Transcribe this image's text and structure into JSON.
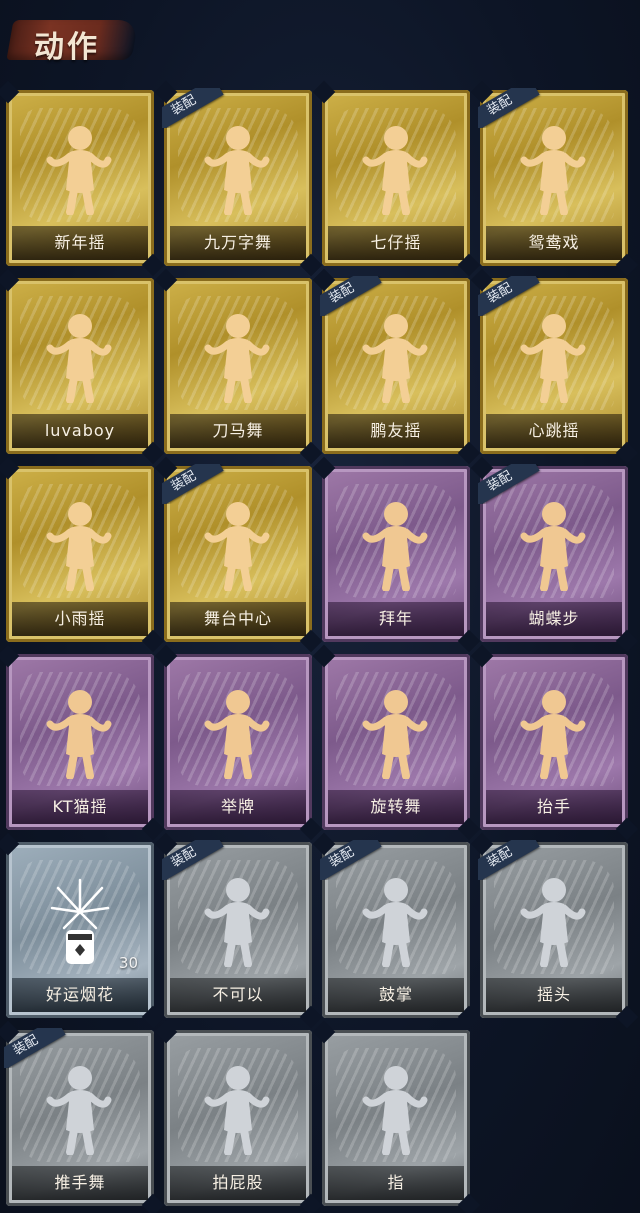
{
  "header": {
    "title": "动作"
  },
  "badge_text": "装配",
  "cards": [
    {
      "label": "新年摇",
      "rarity": "gold",
      "equipped": false
    },
    {
      "label": "九万字舞",
      "rarity": "gold",
      "equipped": true
    },
    {
      "label": "七仔摇",
      "rarity": "gold",
      "equipped": false
    },
    {
      "label": "鸳鸯戏",
      "rarity": "gold",
      "equipped": true
    },
    {
      "label": "luvaboy",
      "rarity": "gold",
      "equipped": false
    },
    {
      "label": "刀马舞",
      "rarity": "gold",
      "equipped": false
    },
    {
      "label": "鹏友摇",
      "rarity": "gold",
      "equipped": true
    },
    {
      "label": "心跳摇",
      "rarity": "gold",
      "equipped": true
    },
    {
      "label": "小雨摇",
      "rarity": "gold",
      "equipped": false
    },
    {
      "label": "舞台中心",
      "rarity": "gold",
      "equipped": true
    },
    {
      "label": "拜年",
      "rarity": "purple",
      "equipped": false
    },
    {
      "label": "蝴蝶步",
      "rarity": "purple",
      "equipped": true
    },
    {
      "label": "KT猫摇",
      "rarity": "purple",
      "equipped": false
    },
    {
      "label": "举牌",
      "rarity": "purple",
      "equipped": false
    },
    {
      "label": "旋转舞",
      "rarity": "purple",
      "equipped": false
    },
    {
      "label": "抬手",
      "rarity": "purple",
      "equipped": false
    },
    {
      "label": "好运烟花",
      "rarity": "blue",
      "equipped": false,
      "count": "30"
    },
    {
      "label": "不可以",
      "rarity": "grey",
      "equipped": true
    },
    {
      "label": "鼓掌",
      "rarity": "grey",
      "equipped": true
    },
    {
      "label": "摇头",
      "rarity": "grey",
      "equipped": true
    },
    {
      "label": "推手舞",
      "rarity": "grey",
      "equipped": true
    },
    {
      "label": "拍屁股",
      "rarity": "grey",
      "equipped": false
    },
    {
      "label": "指",
      "rarity": "grey",
      "equipped": false
    }
  ],
  "icons": {
    "figure": "dancing-figure-icon",
    "firework": "firework-can-icon"
  }
}
